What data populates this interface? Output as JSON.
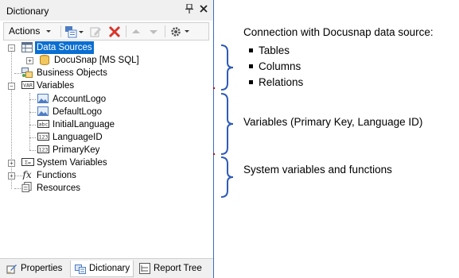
{
  "panel": {
    "title": "Dictionary",
    "pin_glyph": "📌",
    "close_glyph": "✕"
  },
  "toolbar": {
    "actions_label": "Actions",
    "icons": [
      "new-items-icon",
      "edit-icon",
      "delete-icon",
      "move-up-icon",
      "move-down-icon",
      "settings-icon"
    ]
  },
  "tree": {
    "data_sources": "Data Sources",
    "docusnap": "DocuSnap [MS SQL]",
    "business_objects": "Business Objects",
    "variables": "Variables",
    "var_items": [
      "AccountLogo",
      "DefaultLogo",
      "InitialLanguage",
      "LanguageID",
      "PrimaryKey"
    ],
    "system_variables": "System Variables",
    "functions": "Functions",
    "resources": "Resources"
  },
  "tabs": {
    "properties": "Properties",
    "dictionary": "Dictionary",
    "report_tree": "Report Tree"
  },
  "annotations": {
    "connection_title": "Connection with Docusnap data source:",
    "connection_items": [
      "Tables",
      "Columns",
      "Relations"
    ],
    "variables_note": "Variables (Primary Key, Language ID)",
    "system_note": "System variables and functions",
    "brace_color": "#2f5bb7"
  },
  "colors": {
    "selection": "#0a6ed1",
    "panel_border": "#3c6dbd",
    "delete_red": "#d9342b"
  }
}
